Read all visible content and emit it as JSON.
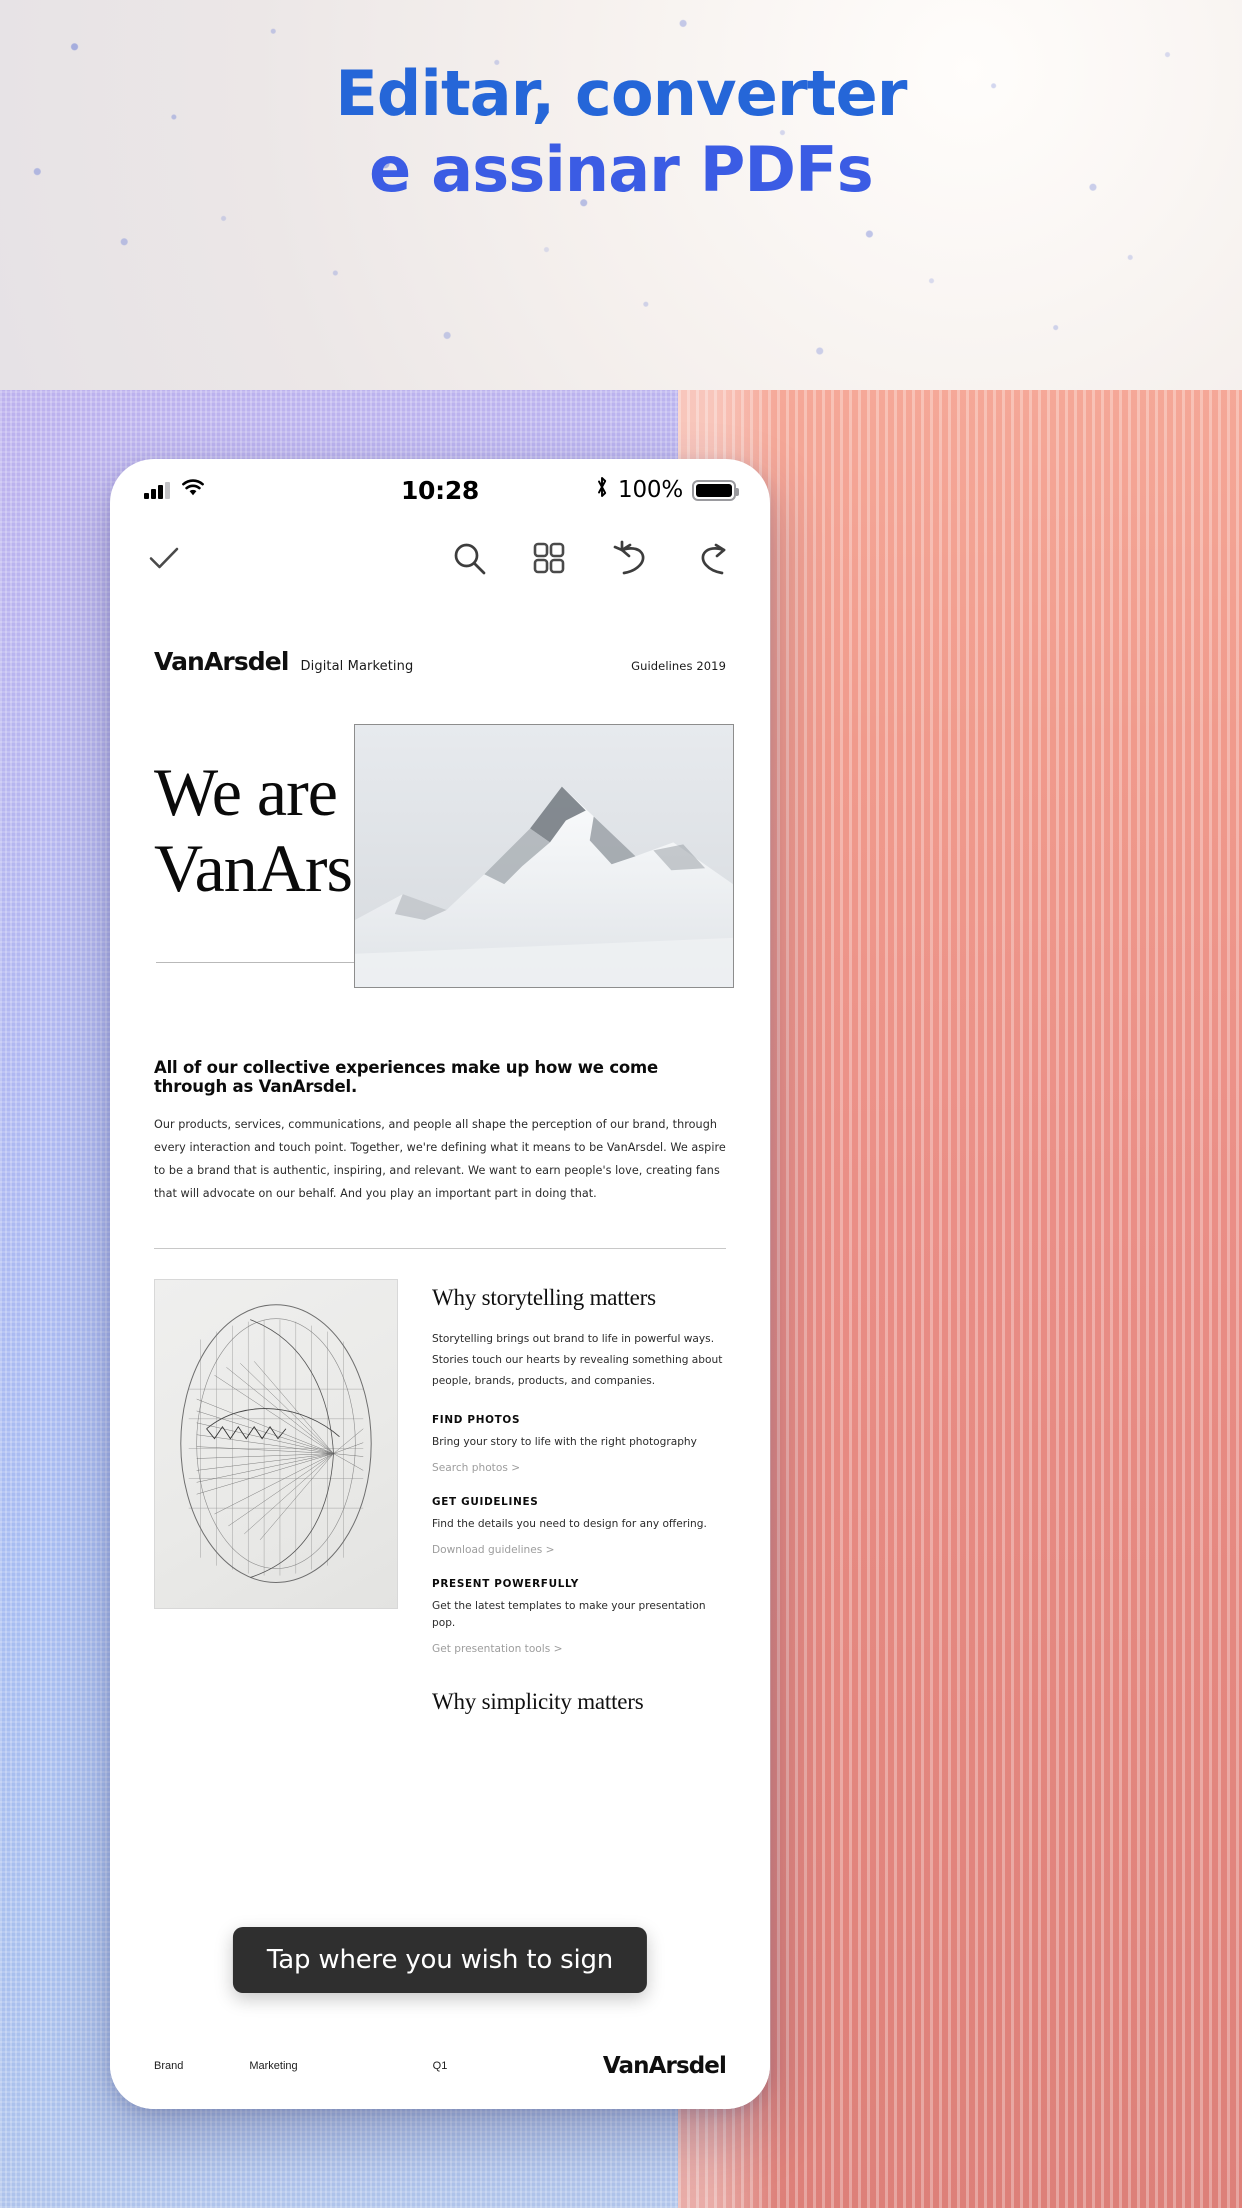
{
  "hero": {
    "line1": "Editar, converter",
    "line2": "e assinar PDFs",
    "color": "#2566d8"
  },
  "statusbar": {
    "signal_icon": "cellular-signal-icon",
    "wifi_icon": "wifi-icon",
    "time": "10:28",
    "bluetooth_icon": "bluetooth-icon",
    "battery_percent": "100%",
    "battery_icon": "battery-full-icon"
  },
  "toolbar": {
    "done_icon": "checkmark-icon",
    "search_icon": "search-icon",
    "grid_icon": "grid-view-icon",
    "undo_icon": "undo-icon",
    "redo_icon": "redo-icon"
  },
  "document": {
    "header": {
      "brand": "VanArsdel",
      "brand_sub": "Digital Marketing",
      "right_label": "Guidelines 2019"
    },
    "hero": {
      "title_line1": "We are",
      "title_line2": "VanArsdel.",
      "photo_alt": "snowy-mountain-photo"
    },
    "sub_head": "All of our collective experiences make up how we come through as VanArsdel.",
    "body": "Our products, services, communications, and people all shape the perception of our brand, through every interaction and touch point. Together, we're defining what it means to be VanArsdel. We aspire to be a brand that is authentic, inspiring, and relevant. We want to earn people's love, creating fans that will advocate on our behalf. And you play an important part in doing that.",
    "columns": {
      "sketch_alt": "geometric-line-sketch",
      "why_title": "Why storytelling matters",
      "why_body": "Storytelling brings out brand to life in powerful ways. Stories touch our hearts by revealing something about people, brands, products, and companies.",
      "items": [
        {
          "kicker": "FIND PHOTOS",
          "body": "Bring your story to life with the right photography",
          "link": "Search photos >"
        },
        {
          "kicker": "GET GUIDELINES",
          "body": "Find the details you need to design for any offering.",
          "link": "Download guidelines >"
        },
        {
          "kicker": "PRESENT POWERFULLY",
          "body": "Get the latest templates to make your presentation pop.",
          "link": "Get presentation tools >"
        }
      ],
      "why_title2": "Why simplicity matters"
    },
    "footer": {
      "left": "Brand",
      "second": "Marketing",
      "center": "Q1",
      "logo": "VanArsdel"
    }
  },
  "tooltip": {
    "label": "Tap where you wish to sign",
    "bg": "#2f2f2f"
  }
}
